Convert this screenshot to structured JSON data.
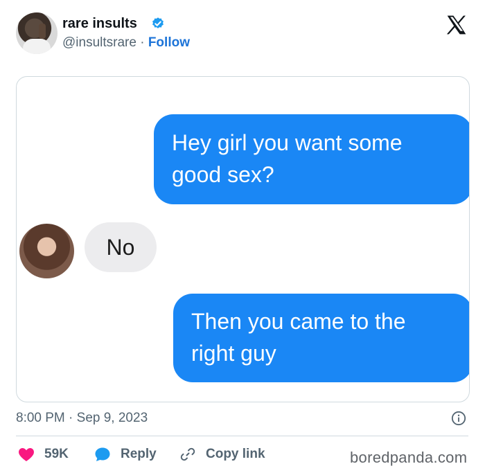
{
  "author": {
    "name": "rare insults",
    "handle": "@insultsrare",
    "separator": "·",
    "follow_label": "Follow"
  },
  "media": {
    "message_1": "Hey girl you want some good sex?",
    "reply": "No",
    "message_2": "Then you came to the right guy"
  },
  "timestamp": {
    "time": "8:00 PM",
    "separator": "·",
    "date": "Sep 9, 2023"
  },
  "actions": {
    "likes_count": "59K",
    "reply_label": "Reply",
    "copy_link_label": "Copy link"
  },
  "watermark": "boredpanda.com",
  "colors": {
    "accent": "#1d74d8",
    "bubble_blue": "#1a87f5",
    "like_red": "#f91880",
    "secondary_text": "#536471"
  },
  "icons": [
    "verified-badge-icon",
    "x-logo-icon",
    "info-icon",
    "heart-icon",
    "reply-bubble-icon",
    "link-icon"
  ]
}
